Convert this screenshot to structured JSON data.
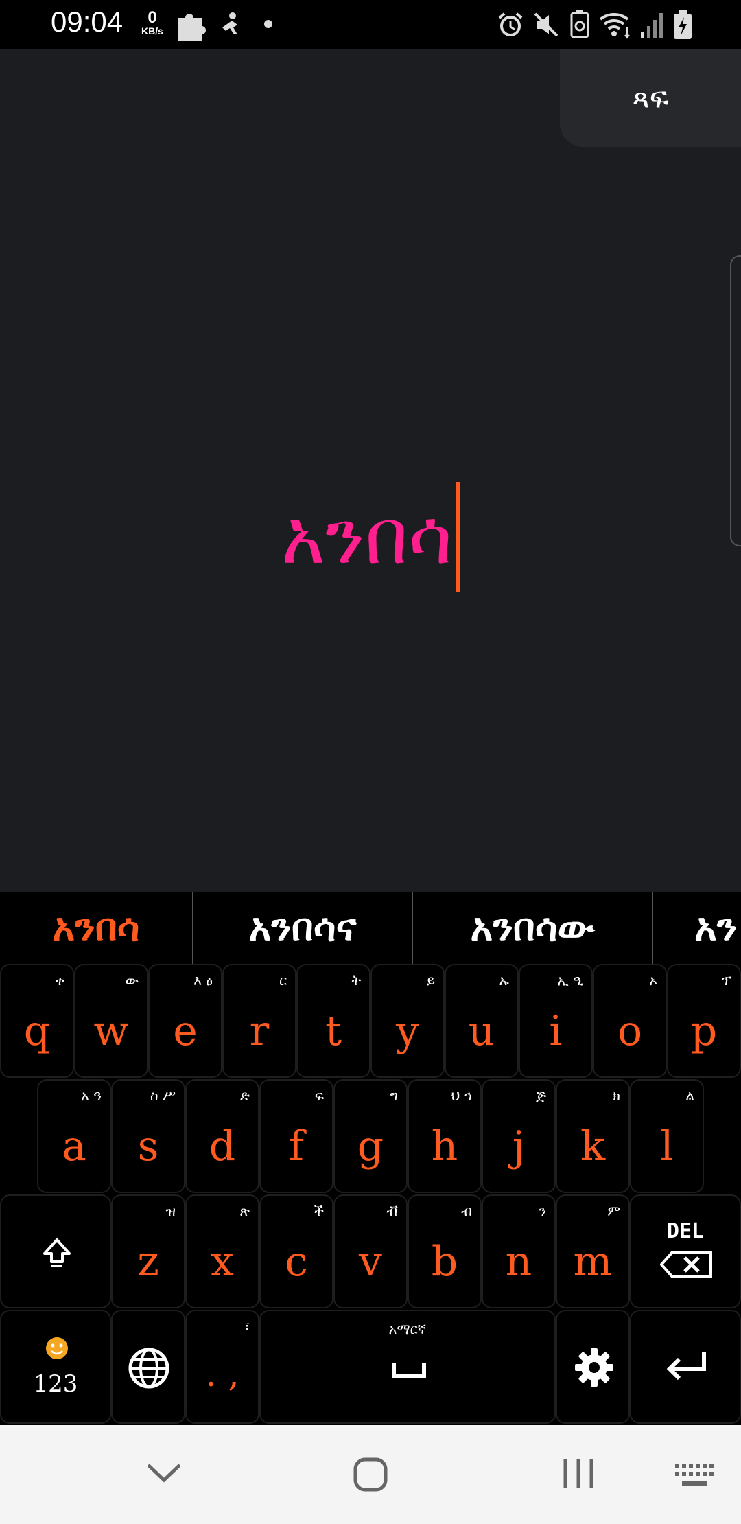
{
  "status_bar": {
    "time": "09:04",
    "net_speed_value": "0",
    "net_speed_unit": "KB/s"
  },
  "app": {
    "apply_label": "ጻፍ",
    "typed_text": "አንበሳ"
  },
  "suggestions": [
    {
      "text": "አንበሳ"
    },
    {
      "text": "አንበሳና"
    },
    {
      "text": "አንበሳው"
    },
    {
      "text": "አን"
    }
  ],
  "keyboard": {
    "row1": [
      {
        "key": "q",
        "hint": "ቀ"
      },
      {
        "key": "w",
        "hint": "ው"
      },
      {
        "key": "e",
        "hint": "እ ፅ"
      },
      {
        "key": "r",
        "hint": "ር"
      },
      {
        "key": "t",
        "hint": "ት"
      },
      {
        "key": "y",
        "hint": "ይ"
      },
      {
        "key": "u",
        "hint": "ኡ"
      },
      {
        "key": "i",
        "hint": "ኢ ዒ"
      },
      {
        "key": "o",
        "hint": "ኦ"
      },
      {
        "key": "p",
        "hint": "ፕ"
      }
    ],
    "row2": [
      {
        "key": "a",
        "hint": "አ ዓ"
      },
      {
        "key": "s",
        "hint": "ስ ሥ"
      },
      {
        "key": "d",
        "hint": "ድ"
      },
      {
        "key": "f",
        "hint": "ፍ"
      },
      {
        "key": "g",
        "hint": "ግ"
      },
      {
        "key": "h",
        "hint": "ህ ኅ"
      },
      {
        "key": "j",
        "hint": "ጅ"
      },
      {
        "key": "k",
        "hint": "ክ"
      },
      {
        "key": "l",
        "hint": "ል"
      }
    ],
    "row3": [
      {
        "key": "z",
        "hint": "ዝ"
      },
      {
        "key": "x",
        "hint": "ጽ"
      },
      {
        "key": "c",
        "hint": "ች"
      },
      {
        "key": "v",
        "hint": "ቭ"
      },
      {
        "key": "b",
        "hint": "ብ"
      },
      {
        "key": "n",
        "hint": "ን"
      },
      {
        "key": "m",
        "hint": "ም"
      }
    ],
    "del_label": "DEL",
    "num_label": "123",
    "punct_label": ". ,",
    "punct_hint": "፣",
    "space_label": "አማርኛ",
    "colors": {
      "accent": "#ff5a1f",
      "typed": "#ff1f8e",
      "key_bg": "#000000"
    }
  }
}
